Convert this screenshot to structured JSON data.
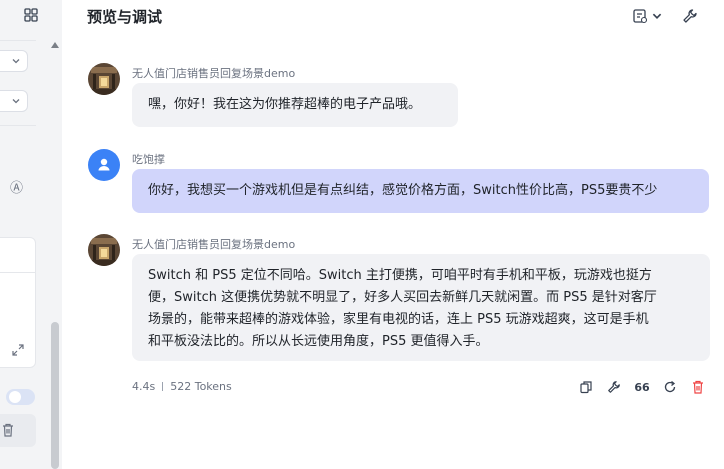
{
  "header": {
    "title": "预览与调试"
  },
  "left_panel": {
    "a_icon": "Ⓐ"
  },
  "messages": [
    {
      "role": "bot",
      "name": "无人值门店销售员回复场景demo",
      "text": "嘿，你好！我在这为你推荐超棒的电子产品哦。"
    },
    {
      "role": "user",
      "name": "吃饱撑",
      "text": "你好，我想买一个游戏机但是有点纠结，感觉价格方面，Switch性价比高，PS5要贵不少"
    },
    {
      "role": "bot",
      "name": "无人值门店销售员回复场景demo",
      "lines": [
        "Switch 和 PS5 定位不同哈。Switch 主打便携，可咱平时有手机和平板，玩游戏也挺方",
        "便，Switch 这便携优势就不明显了，好多人买回去新鲜几天就闲置。而 PS5 是针对客厅",
        "场景的，能带来超棒的游戏体验，家里有电视的话，连上 PS5 玩游戏超爽，这可是手机",
        "和平板没法比的。所以从长远使用角度，PS5 更值得入手。"
      ]
    }
  ],
  "meta": {
    "time": "4.4s",
    "tokens": "522 Tokens"
  },
  "actions": {
    "quote_label": "66"
  },
  "colors": {
    "accent": "#3b82f6",
    "user_bubble": "#d1d5fb",
    "bot_bubble": "#f1f2f5",
    "danger": "#ef4444"
  }
}
